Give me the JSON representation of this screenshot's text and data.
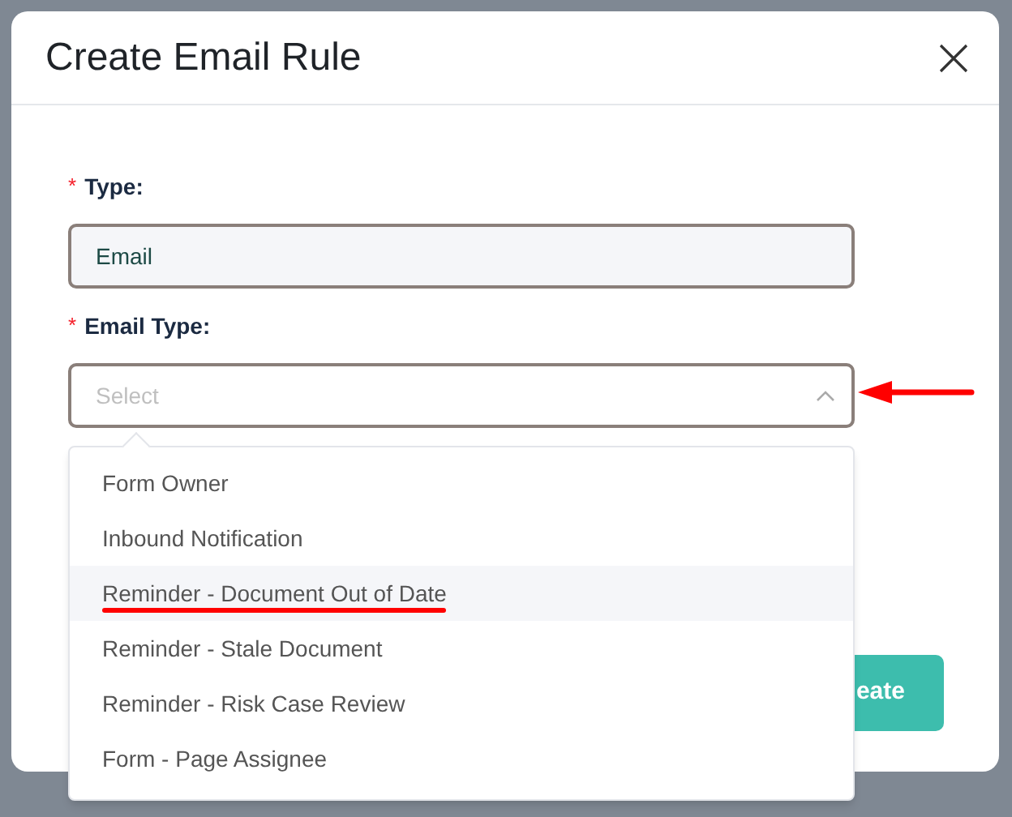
{
  "dialog": {
    "title": "Create Email Rule"
  },
  "fields": [
    {
      "required_mark": "*",
      "label": "Type:",
      "value": "Email"
    },
    {
      "required_mark": "*",
      "label": "Email Type:",
      "placeholder": "Select",
      "expanded": true
    }
  ],
  "dropdown": {
    "options": [
      {
        "label": "Form Owner",
        "selected": false
      },
      {
        "label": "Inbound Notification",
        "selected": false
      },
      {
        "label": "Reminder - Document Out of Date",
        "selected": true
      },
      {
        "label": "Reminder - Stale Document",
        "selected": false
      },
      {
        "label": "Reminder - Risk Case Review",
        "selected": false
      },
      {
        "label": "Form - Page Assignee",
        "selected": false
      }
    ]
  },
  "create_button": {
    "label": "eate"
  }
}
